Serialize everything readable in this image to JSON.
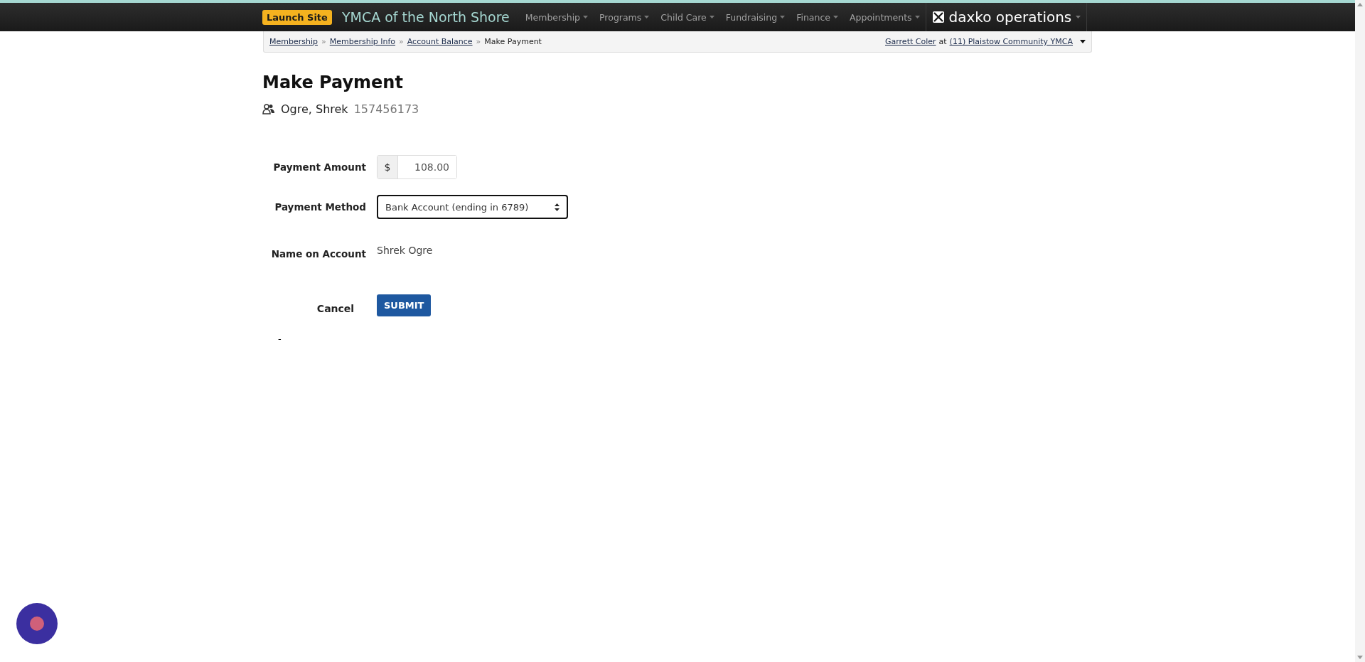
{
  "header": {
    "launch_button": "Launch Site",
    "site_title": "YMCA of the North Shore",
    "menu": [
      {
        "label": "Membership"
      },
      {
        "label": "Programs"
      },
      {
        "label": "Child Care"
      },
      {
        "label": "Fundraising"
      },
      {
        "label": "Finance"
      },
      {
        "label": "Appointments"
      }
    ],
    "product": "daxko operations"
  },
  "breadcrumb": {
    "links": [
      "Membership",
      "Membership Info",
      "Account Balance"
    ],
    "separator": "»",
    "current": "Make Payment"
  },
  "user": {
    "name": "Garrett Coler",
    "joiner": "at",
    "location": "(11) Plaistow Community YMCA"
  },
  "page": {
    "title": "Make Payment",
    "member_name": "Ogre, Shrek",
    "member_id": "157456173"
  },
  "form": {
    "amount": {
      "label": "Payment Amount",
      "prefix": "$",
      "value": "108.00"
    },
    "method": {
      "label": "Payment Method",
      "value": "Bank Account (ending in 6789)"
    },
    "account_name": {
      "label": "Name on Account",
      "value": "Shrek Ogre"
    },
    "cancel": "Cancel",
    "submit": "SUBMIT"
  },
  "footnote": "-"
}
